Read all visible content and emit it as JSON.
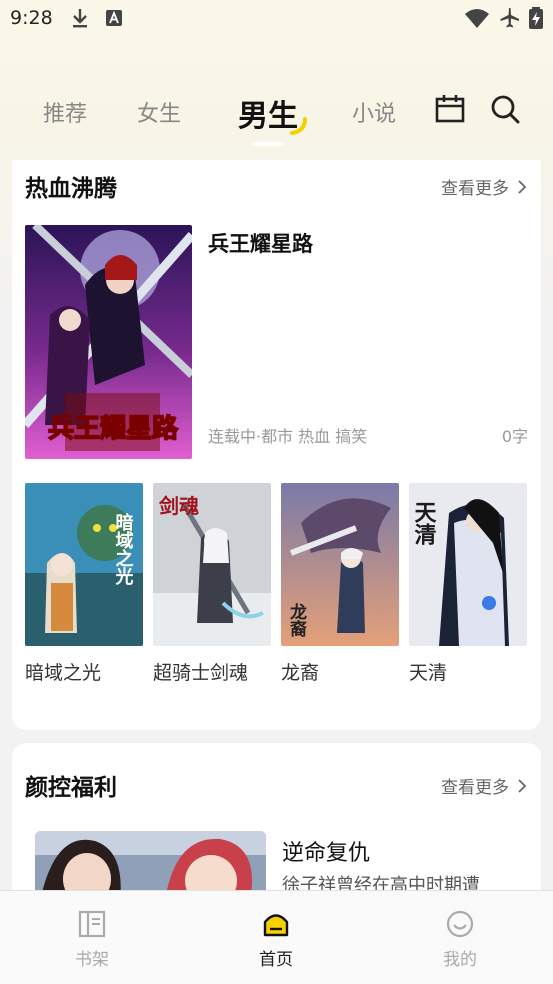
{
  "status_bar": {
    "time": "9:28"
  },
  "tabs": [
    {
      "label": "推荐",
      "active": false
    },
    {
      "label": "女生",
      "active": false
    },
    {
      "label": "男生",
      "active": true
    },
    {
      "label": "小说",
      "active": false
    }
  ],
  "header_icons": [
    "calendar-icon",
    "search-icon"
  ],
  "section1": {
    "title": "热血沸腾",
    "more": "查看更多",
    "featured": {
      "title": "兵王耀星路",
      "meta": "连载中·都市 热血 搞笑",
      "count": "0字",
      "cover_text": "兵王耀星路"
    },
    "items": [
      {
        "title": "暗域之光",
        "cover_text": "暗域之光"
      },
      {
        "title": "超骑士剑魂",
        "cover_text": "剑魂"
      },
      {
        "title": "龙裔",
        "cover_text": "龙裔"
      },
      {
        "title": "天清",
        "cover_text": "天清"
      }
    ]
  },
  "section2": {
    "title": "颜控福利",
    "more": "查看更多",
    "item": {
      "title": "逆命复仇",
      "desc": "徐子祥曾经在高中时期遭"
    }
  },
  "bottom_nav": [
    {
      "label": "书架",
      "icon": "bookshelf-icon",
      "active": false
    },
    {
      "label": "首页",
      "icon": "home-icon",
      "active": true
    },
    {
      "label": "我的",
      "icon": "profile-icon",
      "active": false
    }
  ],
  "colors": {
    "accent": "#f5d000",
    "background": "#f2f2f2",
    "card": "#ffffff"
  }
}
